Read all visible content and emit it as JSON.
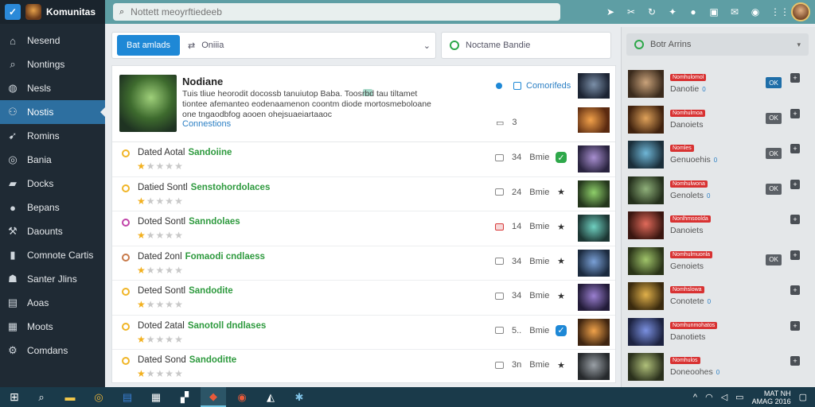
{
  "app": {
    "brand_name": "Komunitas"
  },
  "sidebar": {
    "items": [
      {
        "label": "Nesend",
        "icon": "home-icon"
      },
      {
        "label": "Nontings",
        "icon": "search-icon"
      },
      {
        "label": "Nesls",
        "icon": "chat-icon"
      },
      {
        "label": "Nostis",
        "icon": "users-icon",
        "active": true
      },
      {
        "label": "Romins",
        "icon": "rocket-icon"
      },
      {
        "label": "Bania",
        "icon": "globe-icon"
      },
      {
        "label": "Docks",
        "icon": "folder-icon"
      },
      {
        "label": "Bepans",
        "icon": "circle-icon"
      },
      {
        "label": "Daounts",
        "icon": "wrench-icon"
      },
      {
        "label": "Comnote Cartis",
        "icon": "book-icon"
      },
      {
        "label": "Santer Jlins",
        "icon": "person-icon"
      },
      {
        "label": "Aoas",
        "icon": "file-icon"
      },
      {
        "label": "Moots",
        "icon": "grid-icon"
      },
      {
        "label": "Comdans",
        "icon": "settings-icon"
      }
    ]
  },
  "search": {
    "placeholder": "Nottett meoyrftiedeeb"
  },
  "filters": {
    "primary_button": "Bat amlads",
    "select_value": "Oniiia",
    "right_select": "Noctame Bandie"
  },
  "feature": {
    "title": "Nodiane",
    "description": "Tuis tliue heorodit docossb tanuiutop Baba. Toosrbd tau tiltamet tiontee afemanteo eodenaamenon coontm diode mortosmeboloane one tngaodbfog aooen ohejsuaeiartaaoc",
    "link": "Connestions",
    "status": "Comorifeds",
    "count": "3"
  },
  "rows": [
    {
      "title": "Dated Aotal",
      "highlight": "Sandoiine",
      "rating": 1,
      "count": "34",
      "meta": "Bmie",
      "dot_color": "#f0b527",
      "icon": "check-icon",
      "icon_style": "green",
      "alert": false
    },
    {
      "title": "Datied Sontl",
      "highlight": "Senstohordolaces",
      "rating": 1,
      "count": "24",
      "meta": "Bmie",
      "dot_color": "#f0b527",
      "icon": "star-icon",
      "icon_style": "dark",
      "alert": false
    },
    {
      "title": "Doted Sontl",
      "highlight": "Sanndolaes",
      "rating": 1,
      "count": "14",
      "meta": "Bmie",
      "dot_color": "#c043a8",
      "icon": "star-icon",
      "icon_style": "dark",
      "alert": true
    },
    {
      "title": "Dated 2onl",
      "highlight": "Fomaodi cndlaess",
      "rating": 1,
      "count": "34",
      "meta": "Bmie",
      "dot_color": "#c87a4a",
      "icon": "star-icon",
      "icon_style": "dark",
      "alert": false
    },
    {
      "title": "Deted Sontl",
      "highlight": "Sandodite",
      "rating": 1,
      "count": "34",
      "meta": "Bmie",
      "dot_color": "#f0b527",
      "icon": "star-icon",
      "icon_style": "dark",
      "alert": false
    },
    {
      "title": "Doted 2atal",
      "highlight": "Sanotoll dndlases",
      "rating": 1,
      "count": "5..",
      "meta": "Bmie",
      "dot_color": "#f0b527",
      "icon": "check-icon",
      "icon_style": "blue",
      "alert": false
    },
    {
      "title": "Dated Sond",
      "highlight": "Sandoditte",
      "rating": 1,
      "count": "3n",
      "meta": "Bmie",
      "dot_color": "#f0b527",
      "icon": "star-icon",
      "icon_style": "dark",
      "alert": false
    }
  ],
  "right_panel": {
    "header": "Botr Arrins",
    "items": [
      {
        "badge": "Nomhulomol",
        "name": "Danotie",
        "mark": "0",
        "action": "OK",
        "action_style": "blue"
      },
      {
        "badge": "Nomhulmoa",
        "name": "Danoiets",
        "mark": "",
        "action": "OK",
        "action_style": "dark"
      },
      {
        "badge": "Nomles",
        "name": "Genuoehis",
        "mark": "0",
        "action": "OK",
        "action_style": "dark"
      },
      {
        "badge": "Nomhulwona",
        "name": "Genolets",
        "mark": "0",
        "action": "OK",
        "action_style": "dark"
      },
      {
        "badge": "Nonlhmsoolda",
        "name": "Danoiets",
        "mark": "",
        "action": "",
        "action_style": ""
      },
      {
        "badge": "Nomhulmuonla",
        "name": "Genoiets",
        "mark": "",
        "action": "OK",
        "action_style": "dark"
      },
      {
        "badge": "Nomhslowa",
        "name": "Conotete",
        "mark": "0",
        "action": "",
        "action_style": ""
      },
      {
        "badge": "Nomhunmohatos",
        "name": "Danotiets",
        "mark": "",
        "action": "",
        "action_style": ""
      },
      {
        "badge": "Nomhulos",
        "name": "Doneoohes",
        "mark": "0",
        "action": "",
        "action_style": ""
      }
    ]
  },
  "taskbar": {
    "clock_time": "MAT NH",
    "clock_date": "AMAG 2016"
  }
}
